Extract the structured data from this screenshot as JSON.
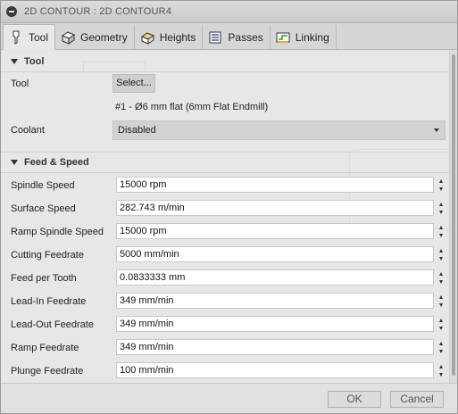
{
  "window": {
    "title": "2D CONTOUR : 2D CONTOUR4"
  },
  "tabs": [
    {
      "label": "Tool",
      "icon": "tool-icon"
    },
    {
      "label": "Geometry",
      "icon": "geometry-icon"
    },
    {
      "label": "Heights",
      "icon": "heights-icon"
    },
    {
      "label": "Passes",
      "icon": "passes-icon"
    },
    {
      "label": "Linking",
      "icon": "linking-icon"
    }
  ],
  "tool_section": {
    "title": "Tool",
    "tool_label": "Tool",
    "select_label": "Select...",
    "tool_name": "#1 - Ø6 mm flat (6mm Flat Endmill)",
    "coolant_label": "Coolant",
    "coolant_value": "Disabled"
  },
  "feed_section": {
    "title": "Feed & Speed",
    "fields": [
      {
        "label": "Spindle Speed",
        "value": "15000 rpm"
      },
      {
        "label": "Surface Speed",
        "value": "282.743 m/min"
      },
      {
        "label": "Ramp Spindle Speed",
        "value": "15000 rpm"
      },
      {
        "label": "Cutting Feedrate",
        "value": "5000 mm/min"
      },
      {
        "label": "Feed per Tooth",
        "value": "0.0833333 mm"
      },
      {
        "label": "Lead-In Feedrate",
        "value": "349 mm/min"
      },
      {
        "label": "Lead-Out Feedrate",
        "value": "349 mm/min"
      },
      {
        "label": "Ramp Feedrate",
        "value": "349 mm/min"
      },
      {
        "label": "Plunge Feedrate",
        "value": "100 mm/min"
      }
    ]
  },
  "footer": {
    "ok_label": "OK",
    "cancel_label": "Cancel"
  }
}
